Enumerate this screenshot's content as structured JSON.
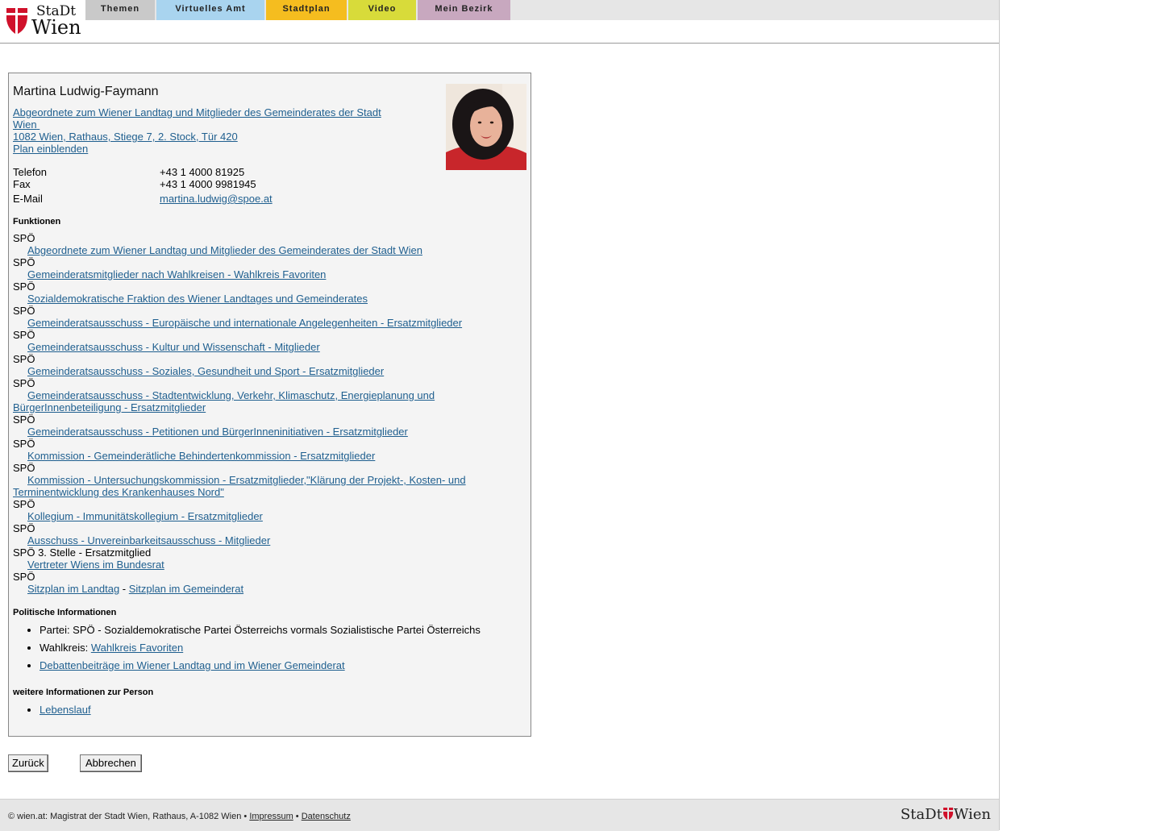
{
  "header": {
    "logo_top": "StaDt",
    "logo_bottom": "Wien",
    "tabs": [
      {
        "label": "Themen",
        "color": "#c9c9c9"
      },
      {
        "label": "Virtuelles Amt",
        "color": "#a9d4ef"
      },
      {
        "label": "Stadtplan",
        "color": "#f5bd1f"
      },
      {
        "label": "Video",
        "color": "#d8db3a"
      },
      {
        "label": "Mein Bezirk",
        "color": "#c8a8bf"
      }
    ]
  },
  "person": {
    "name": "Martina Ludwig-Faymann",
    "position_link_line1": "Abgeordnete zum Wiener Landtag und Mitglieder des Gemeinderates der Stadt",
    "position_link_line2": "Wien",
    "address_link": "1082 Wien, Rathaus, Stiege 7, 2. Stock, Tür 420",
    "plan_link": "Plan einblenden",
    "contact": {
      "telefon_label": "Telefon",
      "telefon": "+43 1 4000 81925",
      "fax_label": "Fax",
      "fax": "+43 1 4000 9981945",
      "email_label": "E-Mail",
      "email": "martina.ludwig@spoe.at"
    }
  },
  "funktionen": {
    "heading": "Funktionen",
    "items": [
      {
        "party": "SPÖ",
        "link": "Abgeordnete zum Wiener Landtag und Mitglieder des Gemeinderates der Stadt Wien"
      },
      {
        "party": "SPÖ",
        "link": "Gemeinderatsmitglieder nach Wahlkreisen - Wahlkreis Favoriten"
      },
      {
        "party": "SPÖ",
        "link": "Sozialdemokratische Fraktion des Wiener Landtages und Gemeinderates"
      },
      {
        "party": "SPÖ",
        "link": "Gemeinderatsausschuss - Europäische und internationale Angelegenheiten - Ersatzmitglieder"
      },
      {
        "party": "SPÖ",
        "link": "Gemeinderatsausschuss - Kultur und Wissenschaft - Mitglieder"
      },
      {
        "party": "SPÖ",
        "link": "Gemeinderatsausschuss - Soziales, Gesundheit und Sport - Ersatzmitglieder"
      },
      {
        "party": "SPÖ",
        "link": "Gemeinderatsausschuss - Stadtentwicklung, Verkehr, Klimaschutz, Energieplanung und BürgerInnenbeteiligung - Ersatzmitglieder"
      },
      {
        "party": "SPÖ",
        "link": "Gemeinderatsausschuss - Petitionen und BürgerInneninitiativen - Ersatzmitglieder"
      },
      {
        "party": "SPÖ",
        "link": "Kommission - Gemeinderätliche Behindertenkommission - Ersatzmitglieder"
      },
      {
        "party": "SPÖ",
        "link": "Kommission - Untersuchungskommission - Ersatzmitglieder,\"Klärung der Projekt-, Kosten- und Terminentwicklung des Krankenhauses Nord\""
      },
      {
        "party": "SPÖ",
        "link": "Kollegium - Immunitätskollegium - Ersatzmitglieder"
      },
      {
        "party": "SPÖ",
        "link": "Ausschuss - Unvereinbarkeitsausschuss - Mitglieder"
      },
      {
        "party": "SPÖ 3. Stelle - Ersatzmitglied",
        "link": "Vertreter Wiens im Bundesrat"
      }
    ],
    "last_party": "SPÖ",
    "sitzplan_landtag": "Sitzplan im Landtag",
    "sitzplan_separator": " - ",
    "sitzplan_gemeinderat": "Sitzplan im Gemeinderat"
  },
  "politische_informationen": {
    "heading": "Politische Informationen",
    "partei": "Partei: SPÖ - Sozialdemokratische Partei Österreichs vormals Sozialistische Partei Österreichs",
    "wahlkreis_label": "Wahlkreis: ",
    "wahlkreis_link": "Wahlkreis Favoriten",
    "debatten_link": "Debattenbeiträge im Wiener Landtag und im Wiener Gemeinderat"
  },
  "weitere_informationen": {
    "heading": "weitere Informationen zur Person",
    "lebenslauf_link": "Lebenslauf"
  },
  "buttons": {
    "back": "Zurück",
    "cancel": "Abbrechen"
  },
  "footer": {
    "text": "© wien.at: Magistrat der Stadt Wien, Rathaus, A-1082 Wien • ",
    "impressum": "Impressum",
    "bullet": " • ",
    "datenschutz": "Datenschutz",
    "logo_left": "StaDt",
    "logo_right": "Wien"
  }
}
